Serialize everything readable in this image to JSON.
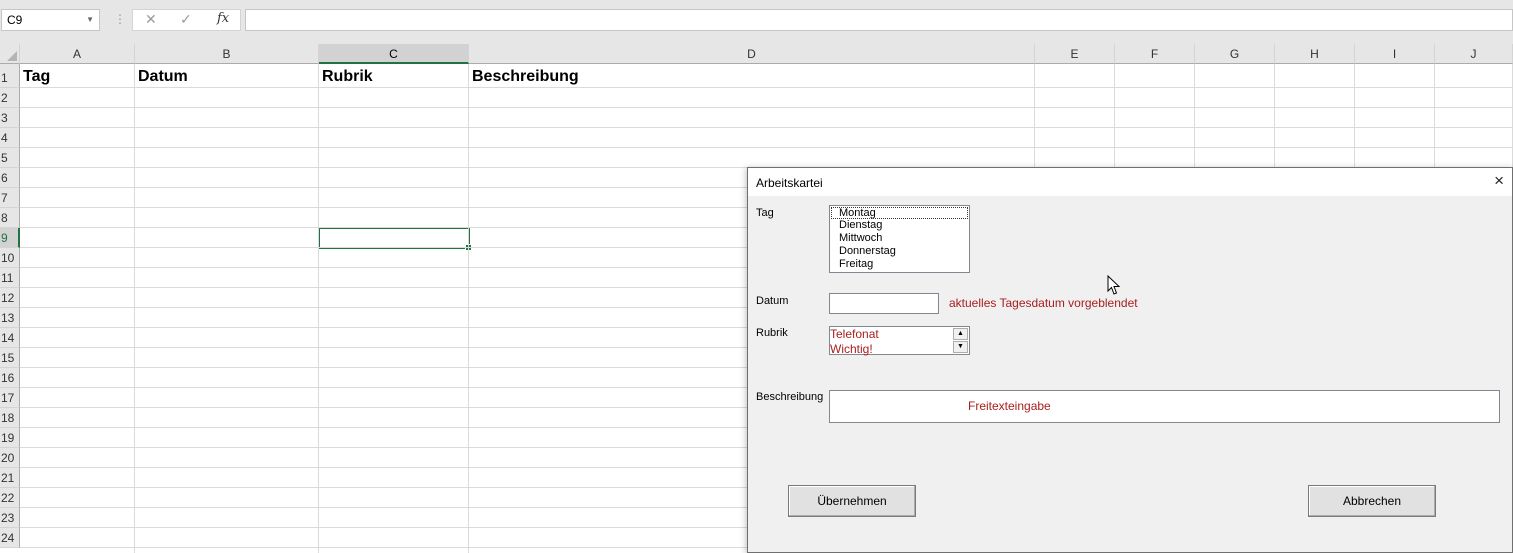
{
  "formula_bar": {
    "name_box": "C9",
    "cancel_icon": "✕",
    "enter_icon": "✓",
    "fx_label": "fx",
    "formula": ""
  },
  "sheet": {
    "columns": [
      "A",
      "B",
      "C",
      "D",
      "E",
      "F",
      "G",
      "H",
      "I",
      "J"
    ],
    "rows": [
      "1",
      "2",
      "3",
      "4",
      "5",
      "6",
      "7",
      "8",
      "9",
      "10",
      "11",
      "12",
      "13",
      "14",
      "15",
      "16",
      "17",
      "18",
      "19",
      "20",
      "21",
      "22",
      "23",
      "24"
    ],
    "selected_cell": "C9",
    "headers": {
      "a1": "Tag",
      "b1": "Datum",
      "c1": "Rubrik",
      "d1": "Beschreibung"
    }
  },
  "dialog": {
    "title": "Arbeitskartei",
    "close_icon": "×",
    "tag_label": "Tag",
    "tag_options": [
      "Montag",
      "Dienstag",
      "Mittwoch",
      "Donnerstag",
      "Freitag"
    ],
    "datum_label": "Datum",
    "datum_value": "",
    "datum_hint": "aktuelles Tagesdatum vorgeblendet",
    "rubrik_label": "Rubrik",
    "rubrik_options": [
      "Telefonat",
      "Wichtig!"
    ],
    "beschreibung_label": "Beschreibung",
    "beschreibung_hint": "Freitexteingabe",
    "ok_button": "Übernehmen",
    "cancel_button": "Abbrechen"
  },
  "colors": {
    "accent": "#217346",
    "hint_red": "#a81e1e"
  }
}
